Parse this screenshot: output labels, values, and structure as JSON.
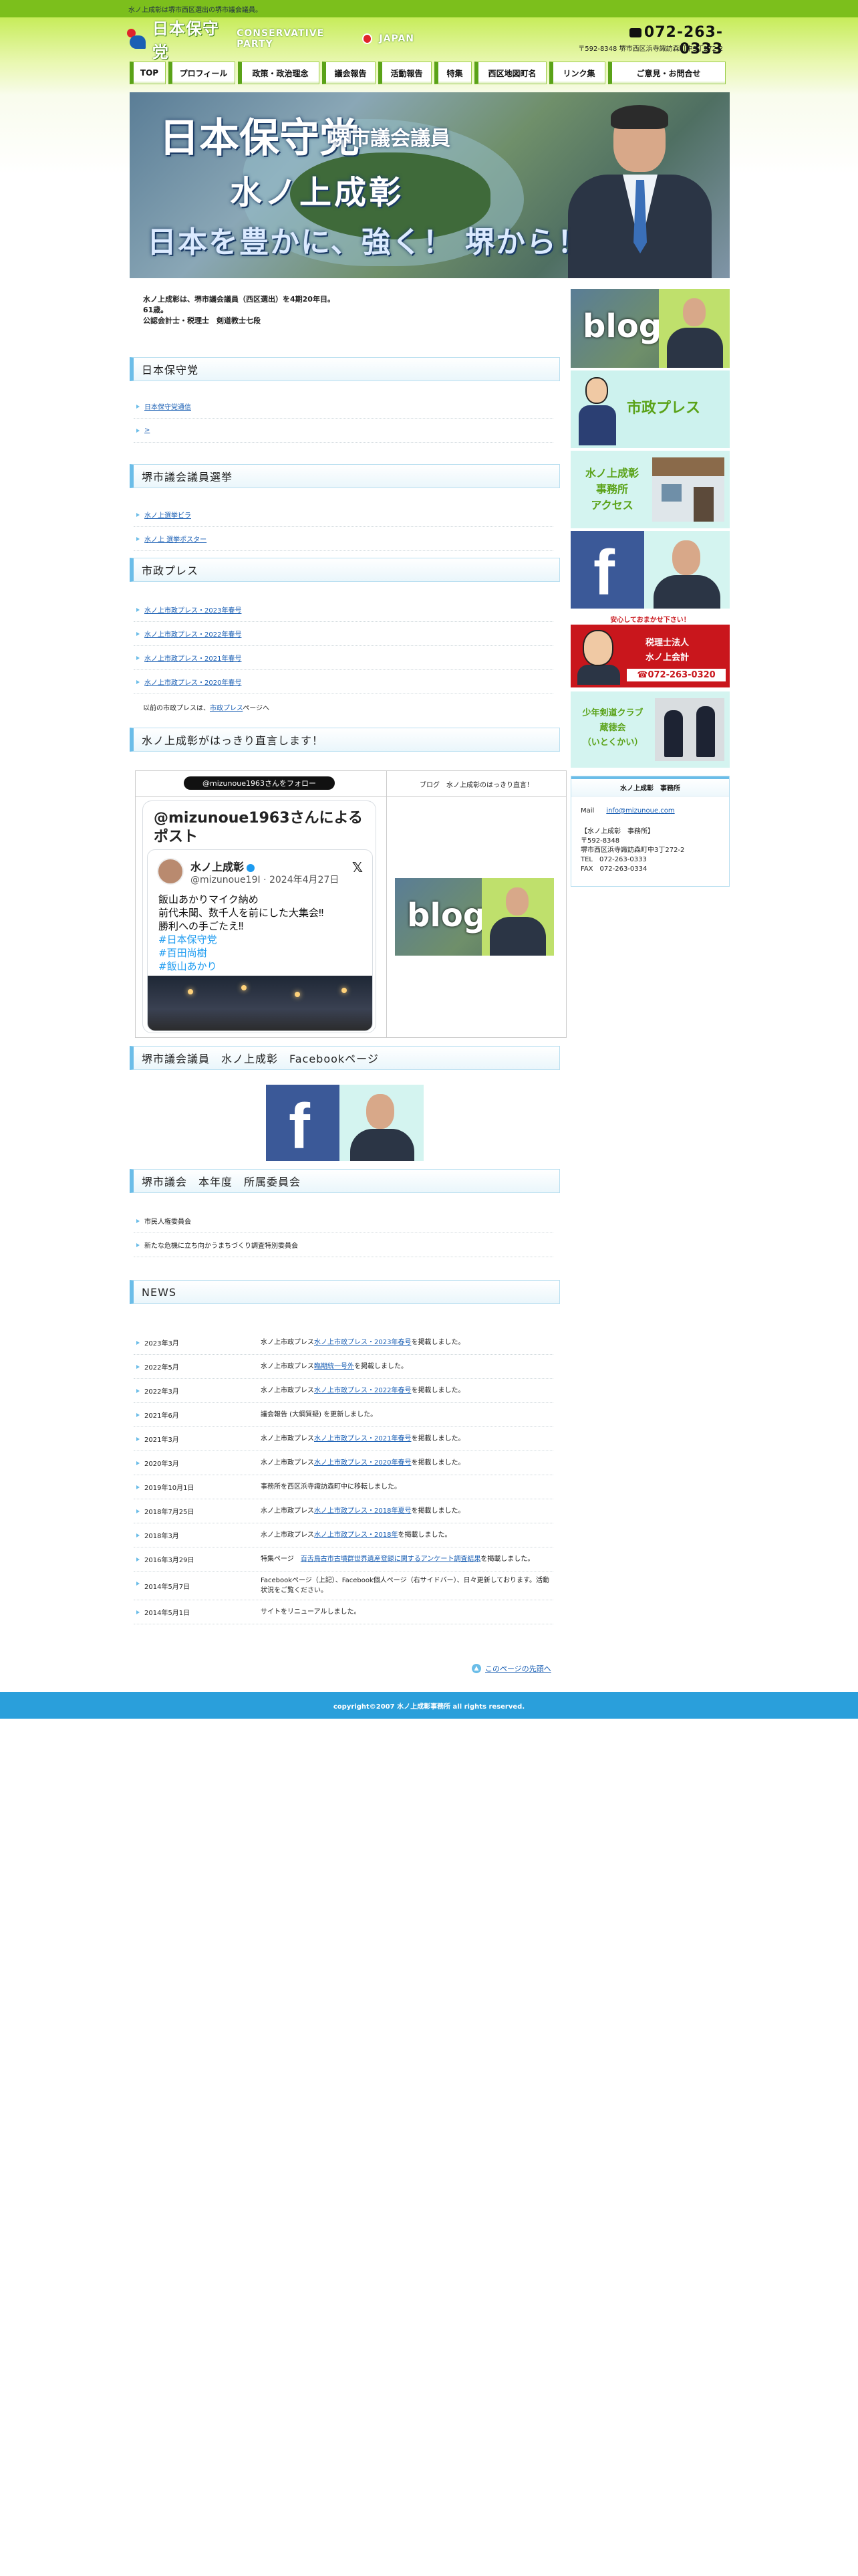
{
  "topbar": {
    "text": "水ノ上成彰は堺市西区選出の堺市議会議員。"
  },
  "header": {
    "logo_text": "日本保守党",
    "logo_en": "CONSERVATIVE PARTY",
    "logo_en2": "JAPAN",
    "phone": "072-263-0333",
    "address": "〒592-8348 堺市西区浜寺諏訪森町中3丁272-2"
  },
  "nav": [
    {
      "label": "TOP"
    },
    {
      "label": "プロフィール"
    },
    {
      "label": "政策・政治理念"
    },
    {
      "label": "議会報告"
    },
    {
      "label": "活動報告"
    },
    {
      "label": "特集"
    },
    {
      "label": "西区地図町名"
    },
    {
      "label": "リンク集"
    },
    {
      "label": "ご意見・お問合せ"
    }
  ],
  "hero": {
    "line1": "日本保守党",
    "line2": "堺市議会議員",
    "line3": "水ノ上成彰",
    "line4": "日本を豊かに、強く！ 堺から！"
  },
  "intro": {
    "line1": "水ノ上成彰は、堺市議会議員（西区選出）を4期20年目。",
    "line2": "61歳。",
    "line3": "公認会計士・税理士　剣道教士七段"
  },
  "sections": {
    "party": "日本保守党",
    "election": "堺市議会議員選挙",
    "press": "市政プレス",
    "twitter": "水ノ上成彰がはっきり直言します！",
    "facebook": "堺市議会議員　水ノ上成彰　Facebookページ",
    "committee": "堺市議会　本年度　所属委員会",
    "news": "NEWS"
  },
  "party_links": [
    "日本保守党通信",
    ">"
  ],
  "election_links": [
    "水ノ上選挙ビラ",
    "水ノ上 選挙ポスター"
  ],
  "press_links": [
    "水ノ上市政プレス・2023年春号",
    "水ノ上市政プレス・2022年春号",
    "水ノ上市政プレス・2021年春号",
    "水ノ上市政プレス・2020年春号"
  ],
  "press_note": {
    "prefix": "以前の市政プレスは、",
    "link": "市政プレス",
    "suffix": "ページへ"
  },
  "twitter_box": {
    "follow": "@mizunoue1963さんをフォロー",
    "blog_caption": "ブログ　水ノ上成彰のはっきり直言！",
    "title": "@mizunoue1963さんによるポスト",
    "name": "水ノ上成彰",
    "handle": "@mizunoue19I · 2024年4月27日",
    "body1": "飯山あかりマイク納め",
    "body2": "前代未聞、数千人を前にした大集会‼",
    "body3": "勝利への手ごたえ‼",
    "tag1": "#日本保守党",
    "tag2": "#百田尚樹",
    "tag3": "#飯山あかり",
    "blog_text": "blog"
  },
  "committee": [
    "市民人権委員会",
    "新たな危機に立ち向かうまちづくり調査特別委員会"
  ],
  "news": [
    {
      "date": "2023年3月",
      "pre": "水ノ上市政プレス",
      "link": "水ノ上市政プレス・2023年春号",
      "post": "を掲載しました。"
    },
    {
      "date": "2022年5月",
      "pre": "水ノ上市政プレス",
      "link": "臨期統一号外",
      "post": "を掲載しました。"
    },
    {
      "date": "2022年3月",
      "pre": "水ノ上市政プレス",
      "link": "水ノ上市政プレス・2022年春号",
      "post": "を掲載しました。"
    },
    {
      "date": "2021年6月",
      "pre": "議会報告 (大綱質疑) を更新しました。",
      "link": "",
      "post": ""
    },
    {
      "date": "2021年3月",
      "pre": "水ノ上市政プレス",
      "link": "水ノ上市政プレス・2021年春号",
      "post": "を掲載しました。"
    },
    {
      "date": "2020年3月",
      "pre": "水ノ上市政プレス",
      "link": "水ノ上市政プレス・2020年春号",
      "post": "を掲載しました。"
    },
    {
      "date": "2019年10月1日",
      "pre": "事務所を西区浜寺諏訪森町中に移転しました。",
      "link": "",
      "post": ""
    },
    {
      "date": "2018年7月25日",
      "pre": "水ノ上市政プレス",
      "link": "水ノ上市政プレス・2018年夏号",
      "post": "を掲載しました。"
    },
    {
      "date": "2018年3月",
      "pre": "水ノ上市政プレス",
      "link": "水ノ上市政プレス・2018年",
      "post": "を掲載しました。"
    },
    {
      "date": "2016年3月29日",
      "pre": "特集ページ　",
      "link": "百舌鳥古市古墳群世界遺産登録に関するアンケート調査結果",
      "post": "を掲載しました。"
    },
    {
      "date": "2014年5月7日",
      "pre": "Facebookページ（上記）、Facebook個人ページ（右サイドバー）、日々更新しております。活動状況をご覧ください。",
      "link": "",
      "post": ""
    },
    {
      "date": "2014年5月1日",
      "pre": "サイトをリニューアルしました。",
      "link": "",
      "post": ""
    }
  ],
  "pagetop": "このページの先頭へ",
  "footer": "copyright©2007 水ノ上成彰事務所 all rights reserved.",
  "sidebar": {
    "blog_text": "blog",
    "press_text": "市政プレス",
    "access_l1": "水ノ上成彰",
    "access_l2": "事務所",
    "access_l3": "アクセス",
    "fb_text": "f",
    "tax_strip": "安心しておまかせ下さい！",
    "tax_l1": "税理士法人",
    "tax_l2": "水ノ上会計",
    "tax_phone": "☎072-263-0320",
    "kendo_l1": "少年剣道クラブ",
    "kendo_l2": "蔵徳会",
    "kendo_l3": "（いとくかい）",
    "office_title": "水ノ上成彰　事務所",
    "mail_label": "Mail",
    "mail": "info@mizunoue.com",
    "o1": "【水ノ上成彰　事務所】",
    "o2": "〒592-8348",
    "o3": "堺市西区浜寺諏訪森町中3丁272-2",
    "o4": "TEL　072-263-0333",
    "o5": "FAX　072-263-0334"
  },
  "colors": {
    "accent_green": "#7cbf1c",
    "accent_blue": "#6bbde8",
    "footer_blue": "#2a9fdb"
  }
}
